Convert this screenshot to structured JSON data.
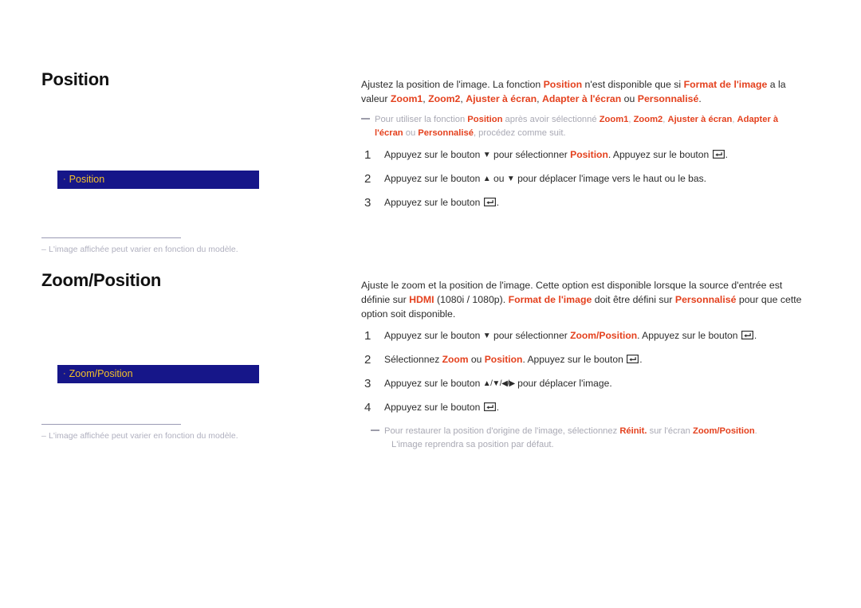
{
  "page": {
    "background": "#ffffff",
    "accent_color": "#e4411e",
    "osd_box_color": "#161689",
    "osd_text_color": "#f3c02a",
    "note_text_color": "#a9a9b4"
  },
  "sections": [
    {
      "id": "position",
      "title": "Position",
      "osd": {
        "bullet": "·",
        "label": "Position"
      },
      "footnote": {
        "dash": "–",
        "text": "L'image affichée peut varier en fonction du modèle."
      },
      "intro": {
        "p1_a": "Ajustez la position de l'image. La fonction ",
        "p1_b": "Position",
        "p1_c": " n'est disponible que si ",
        "p1_d": "Format de l'image",
        "p1_e": " a la valeur ",
        "p1_f": "Zoom1",
        "p1_g": ", ",
        "p1_h": "Zoom2",
        "p1_i": ", ",
        "p1_j": "Ajuster à écran",
        "p1_k": ", ",
        "p1_l": "Adapter à l'écran",
        "p1_m": " ou ",
        "p1_n": "Personnalisé",
        "p1_o": "."
      },
      "note": {
        "a": "Pour utiliser la fonction ",
        "b": "Position",
        "c": " après avoir sélectionné ",
        "d": "Zoom1",
        "e": ", ",
        "f": "Zoom2",
        "g": ", ",
        "h": "Ajuster à écran",
        "i": ", ",
        "j": "Adapter à l'écran",
        "k": " ou ",
        "l": "Personnalisé",
        "m": ", procédez comme suit."
      },
      "steps": [
        {
          "num": "1",
          "a": "Appuyez sur le bouton ",
          "icon1": "down-arrow-icon",
          "arrow1": "▼",
          "b": " pour sélectionner ",
          "accent1": "Position",
          "c": ". Appuyez sur le bouton ",
          "icon2": "enter-key-icon",
          "d": "."
        },
        {
          "num": "2",
          "a": "Appuyez sur le bouton ",
          "arrow1": "▲",
          "b": " ou ",
          "arrow2": "▼",
          "c": " pour déplacer l'image vers le haut ou le bas."
        },
        {
          "num": "3",
          "a": "Appuyez sur le bouton ",
          "icon1": "enter-key-icon",
          "b": "."
        }
      ]
    },
    {
      "id": "zoomposition",
      "title": "Zoom/Position",
      "osd": {
        "bullet": "·",
        "label": "Zoom/Position"
      },
      "footnote": {
        "dash": "–",
        "text": "L'image affichée peut varier en fonction du modèle."
      },
      "intro": {
        "p1_a": "Ajuste le zoom et la position de l'image. Cette option est disponible lorsque la source d'entrée est définie sur ",
        "p1_b": "HDMI",
        "p1_c": " (1080i / 1080p). ",
        "p1_d": "Format de l'image",
        "p1_e": " doit être défini sur ",
        "p1_f": "Personnalisé",
        "p1_g": " pour que cette option soit disponible."
      },
      "steps": [
        {
          "num": "1",
          "a": "Appuyez sur le bouton ",
          "arrow1": "▼",
          "b": " pour sélectionner ",
          "accent1": "Zoom/Position",
          "c": ". Appuyez sur le bouton ",
          "icon1": "enter-key-icon",
          "d": "."
        },
        {
          "num": "2",
          "a": "Sélectionnez ",
          "accent1": "Zoom",
          "b": " ou ",
          "accent2": "Position",
          "c": ". Appuyez sur le bouton ",
          "icon1": "enter-key-icon",
          "d": "."
        },
        {
          "num": "3",
          "a": "Appuyez sur le bouton ",
          "arrows": "▲/▼/◀/▶",
          "b": " pour déplacer l'image."
        },
        {
          "num": "4",
          "a": "Appuyez sur le bouton ",
          "icon1": "enter-key-icon",
          "b": "."
        }
      ],
      "note": {
        "a": "Pour restaurer la position d'origine de l'image, sélectionnez ",
        "b": "Réinit.",
        "c": " sur l'écran ",
        "d": "Zoom/Position",
        "e": ".",
        "f": "L'image reprendra sa position par défaut."
      }
    }
  ]
}
